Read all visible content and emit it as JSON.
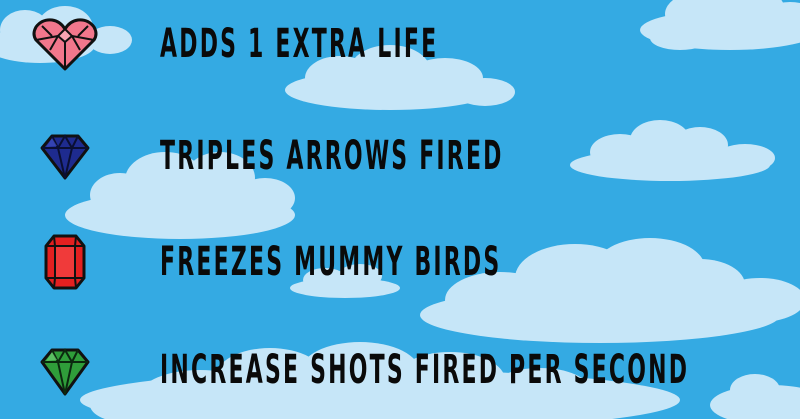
{
  "background_color": "#34aae3",
  "cloud_color": "#c6e6f8",
  "powerups": [
    {
      "icon": "pink-heart-gem-icon",
      "color": "#f2778c",
      "label": "ADDS 1 EXTRA LIFE"
    },
    {
      "icon": "blue-diamond-gem-icon",
      "color": "#1e2b8f",
      "label": "TRIPLES ARROWS FIRED"
    },
    {
      "icon": "red-emerald-cut-gem-icon",
      "color": "#e42020",
      "label": "FREEZES MUMMY BIRDS"
    },
    {
      "icon": "green-diamond-gem-icon",
      "color": "#2f9e3a",
      "label": "INCREASE SHOTS FIRED PER SECOND"
    }
  ]
}
